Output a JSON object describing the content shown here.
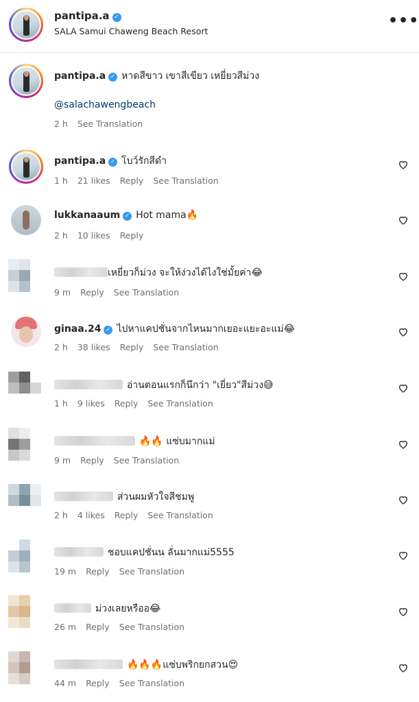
{
  "header": {
    "username": "pantipa.a",
    "location": "SALA Samui Chaweng Beach Resort",
    "more_icon": "more-horizontal-icon",
    "more_label": "•••"
  },
  "caption": {
    "username": "pantipa.a",
    "text": "หาดสีขาว เขาสีเขียว เหยี่ยวสีม่วง",
    "mention": "@salachawengbeach",
    "time": "2 h",
    "translate": "See Translation"
  },
  "comments": [
    {
      "username": "pantipa.a",
      "verified": true,
      "text": "โบว์รักสีดำ",
      "time": "1 h",
      "likes": "21 likes",
      "reply": "Reply",
      "translate": "See Translation"
    },
    {
      "username": "lukkanaaum",
      "verified": true,
      "text": "Hot mama🔥",
      "time": "2 h",
      "likes": "10 likes",
      "reply": "Reply",
      "translate": ""
    },
    {
      "username": "",
      "verified": false,
      "text": "เหยี่ยวก็ม่วง จะให้ง่วงได้ไงใช่มั้ยค่า😂",
      "time": "9 m",
      "likes": "",
      "reply": "Reply",
      "translate": "See Translation"
    },
    {
      "username": "ginaa.24",
      "verified": true,
      "text": "ไปหาแคปชั่นจากไหนมากเยอะแยะอะแม่😂",
      "time": "2 h",
      "likes": "38 likes",
      "reply": "Reply",
      "translate": "See Translation"
    },
    {
      "username": "",
      "verified": false,
      "text": "อ่านตอนแรกก็นึกว่า \"เยี่ยว\"สีม่วง😅",
      "time": "1 h",
      "likes": "9 likes",
      "reply": "Reply",
      "translate": "See Translation"
    },
    {
      "username": "",
      "verified": false,
      "text": "🔥🔥 แซ่บมากแม่",
      "time": "9 m",
      "likes": "",
      "reply": "Reply",
      "translate": "See Translation"
    },
    {
      "username": "",
      "verified": false,
      "text": "ส่วนผมหัวใจสีชมพู",
      "time": "2 h",
      "likes": "4 likes",
      "reply": "Reply",
      "translate": "See Translation"
    },
    {
      "username": "",
      "verified": false,
      "text": "ชอบแคปชั่นน ลั่นมากแม่5555",
      "time": "19 m",
      "likes": "",
      "reply": "Reply",
      "translate": "See Translation"
    },
    {
      "username": "",
      "verified": false,
      "text": "ม่วงเลยหรืออ😂",
      "time": "26 m",
      "likes": "",
      "reply": "Reply",
      "translate": "See Translation"
    },
    {
      "username": "",
      "verified": false,
      "text": "🔥🔥🔥แซ่บพริกยกสวน😍",
      "time": "44 m",
      "likes": "",
      "reply": "Reply",
      "translate": "See Translation"
    }
  ],
  "icons": {
    "heart": "heart-icon",
    "verified": "verified-badge-icon"
  },
  "colors": {
    "verified": "#3897f0",
    "mention": "#00376b",
    "meta": "#6f6f6f"
  }
}
